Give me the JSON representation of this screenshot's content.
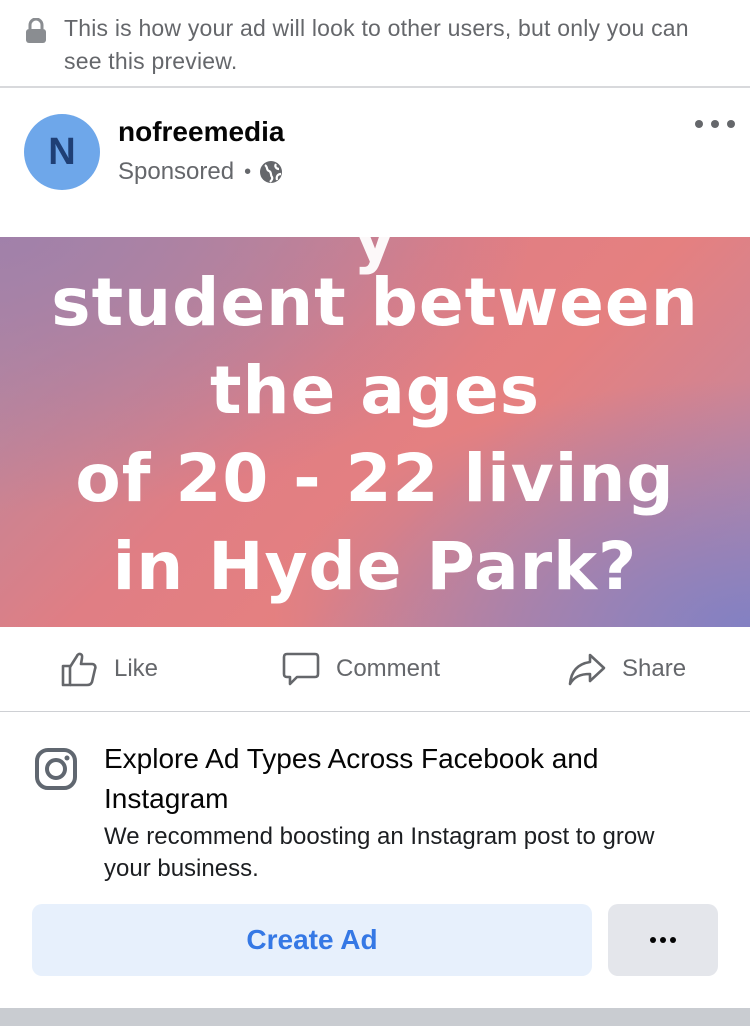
{
  "notice": {
    "text": "This is how your ad will look to other users, but only you can see this preview.",
    "icon": "lock-icon"
  },
  "post": {
    "avatar_letter": "N",
    "avatar_color": "#6ea7ea",
    "page_name": "nofreemedia",
    "sponsored_label": "Sponsored",
    "separator": "•",
    "audience_icon": "globe-icon"
  },
  "creative": {
    "lines": [
      "student between",
      "the ages",
      "of 20 - 22 living",
      "in Hyde Park?"
    ]
  },
  "actions": {
    "like": "Like",
    "comment": "Comment",
    "share": "Share"
  },
  "promo": {
    "icon": "instagram-icon",
    "title": "Explore Ad Types Across Facebook and Instagram",
    "body": "We recommend boosting an Instagram post to grow your business.",
    "cta": "Create Ad",
    "cta_color": "#3578e5"
  }
}
